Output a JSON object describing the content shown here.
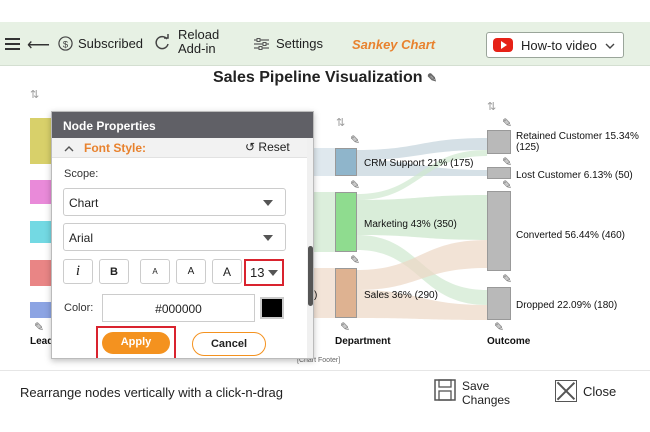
{
  "toolbar": {
    "subscribed": "Subscribed",
    "reload": [
      "Reload",
      "Add-in"
    ],
    "settings": "Settings",
    "brand": "Sankey Chart",
    "howto": "How-to video"
  },
  "chart": {
    "title": "Sales Pipeline Visualization",
    "footer": "[Chart Footer]",
    "columns": {
      "source": "Lead",
      "department": "Department",
      "outcome": "Outcome"
    },
    "department_nodes": [
      {
        "label": "CRM Support 21% (175)",
        "color": "#8fb5cb"
      },
      {
        "label": "Marketing 43% (350)",
        "color": "#8fdc8f"
      },
      {
        "label": "Sales 36% (290)",
        "color": "#deb291"
      }
    ],
    "outcome_nodes": [
      {
        "label": "Retained Customer 15.34%",
        "sub": "(125)",
        "color": "#b9b9b9"
      },
      {
        "label": "Lost Customer 6.13% (50)",
        "sub": "",
        "color": "#b9b9b9"
      },
      {
        "label": "Converted 56.44% (460)",
        "sub": "",
        "color": "#b9b9b9"
      },
      {
        "label": "Dropped 22.09% (180)",
        "sub": "",
        "color": "#b9b9b9"
      }
    ],
    "source_colors": [
      "#d8d06a",
      "#e98ad9",
      "#73d9e3",
      "#e98585",
      "#8ca4e3"
    ],
    "source_partial_label": ")"
  },
  "panel": {
    "title": "Node Properties",
    "section": "Font Style:",
    "reset": "Reset",
    "scope_label": "Scope:",
    "scope_value": "Chart",
    "font_value": "Arial",
    "buttons": [
      "i",
      "B",
      "A",
      "A",
      "A"
    ],
    "font_size": "13",
    "color_label": "Color:",
    "color_value": "#000000",
    "apply": "Apply",
    "cancel": "Cancel"
  },
  "status": {
    "hint": "Rearrange nodes vertically with a click-n-drag",
    "save": [
      "Save",
      "Changes"
    ],
    "close": "Close"
  }
}
